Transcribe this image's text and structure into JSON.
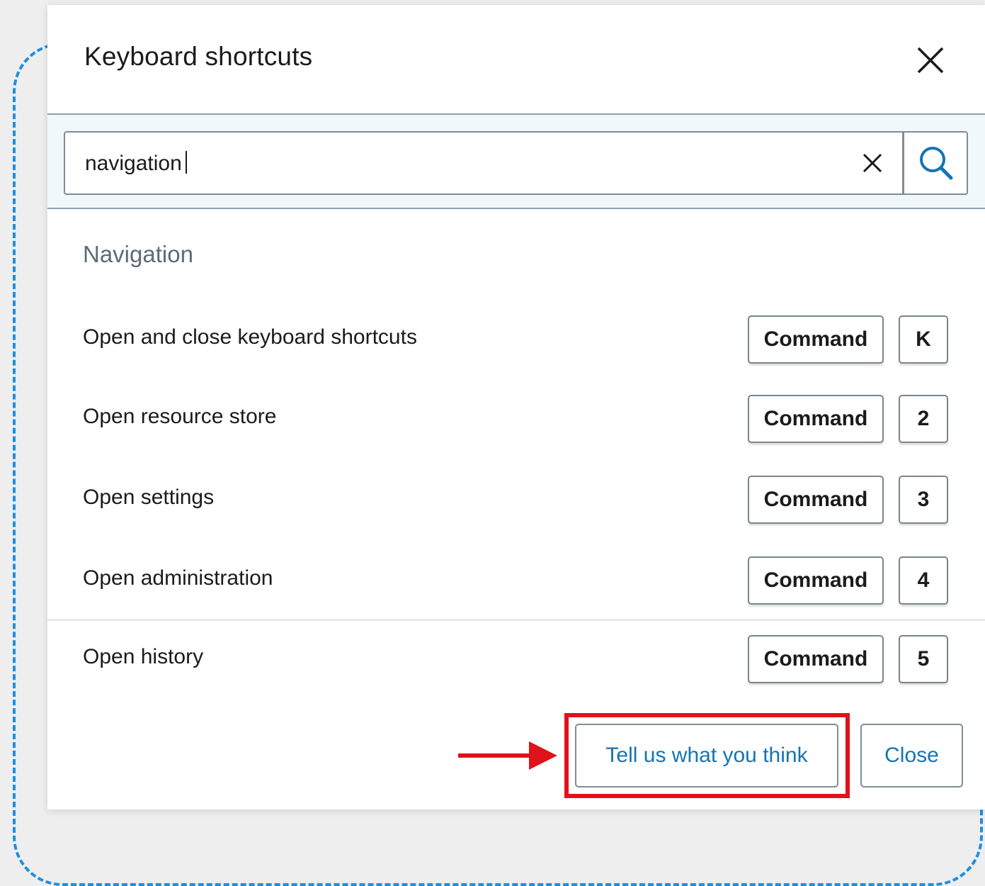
{
  "dialog": {
    "title": "Keyboard shortcuts",
    "close_icon": "close-icon"
  },
  "search": {
    "value": "navigation",
    "clear_icon": "clear-icon",
    "search_icon": "search-icon"
  },
  "section": {
    "heading": "Navigation"
  },
  "shortcuts": [
    {
      "label": "Open and close keyboard shortcuts",
      "modifier": "Command",
      "key": "K"
    },
    {
      "label": "Open resource store",
      "modifier": "Command",
      "key": "2"
    },
    {
      "label": "Open settings",
      "modifier": "Command",
      "key": "3"
    },
    {
      "label": "Open administration",
      "modifier": "Command",
      "key": "4"
    },
    {
      "label": "Open history",
      "modifier": "Command",
      "key": "5"
    }
  ],
  "footer": {
    "feedback_label": "Tell us what you think",
    "close_label": "Close"
  },
  "colors": {
    "accent": "#1474b4",
    "highlight": "#e0121a",
    "frame": "#1e8fe0"
  }
}
